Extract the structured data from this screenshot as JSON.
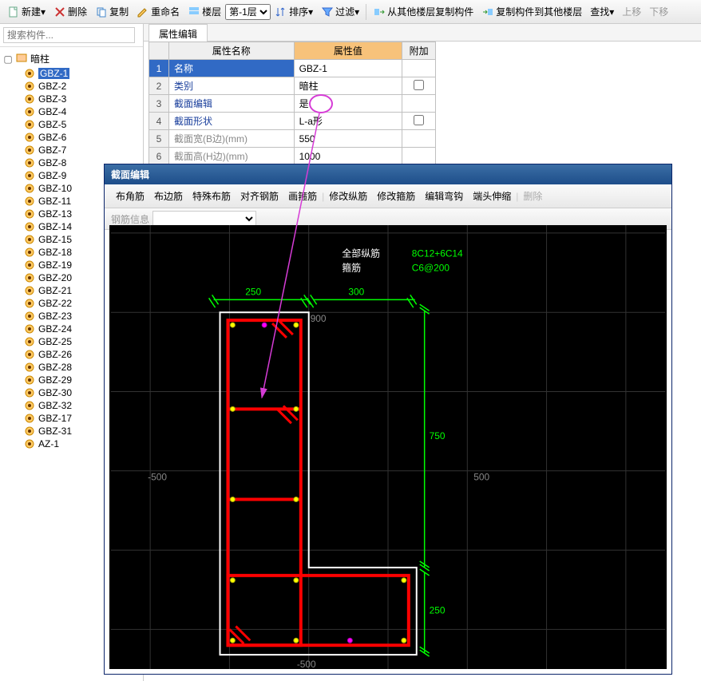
{
  "toolbar": {
    "new": "新建",
    "delete": "删除",
    "copy": "复制",
    "rename": "重命名",
    "floor": "楼层",
    "floor_sel": "第-1层",
    "sort": "排序",
    "filter": "过滤",
    "copy_from": "从其他楼层复制构件",
    "copy_to": "复制构件到其他楼层",
    "find": "查找",
    "up": "上移",
    "down": "下移"
  },
  "search_placeholder": "搜索构件...",
  "tree_root": "暗柱",
  "tree_items": [
    "GBZ-1",
    "GBZ-2",
    "GBZ-3",
    "GBZ-4",
    "GBZ-5",
    "GBZ-6",
    "GBZ-7",
    "GBZ-8",
    "GBZ-9",
    "GBZ-10",
    "GBZ-11",
    "GBZ-13",
    "GBZ-14",
    "GBZ-15",
    "GBZ-18",
    "GBZ-19",
    "GBZ-20",
    "GBZ-21",
    "GBZ-22",
    "GBZ-23",
    "GBZ-24",
    "GBZ-25",
    "GBZ-26",
    "GBZ-28",
    "GBZ-29",
    "GBZ-30",
    "GBZ-32",
    "GBZ-17",
    "GBZ-31",
    "AZ-1"
  ],
  "tab": "属性编辑",
  "headers": {
    "name": "属性名称",
    "value": "属性值",
    "extra": "附加"
  },
  "rows": [
    {
      "n": "1",
      "name": "名称",
      "val": "GBZ-1",
      "chk": null,
      "sel": true
    },
    {
      "n": "2",
      "name": "类别",
      "val": "暗柱",
      "chk": false
    },
    {
      "n": "3",
      "name": "截面编辑",
      "val": "是",
      "chk": null
    },
    {
      "n": "4",
      "name": "截面形状",
      "val": "L-a形",
      "chk": false
    },
    {
      "n": "5",
      "name": "截面宽(B边)(mm)",
      "val": "550",
      "chk": null,
      "gray": true
    },
    {
      "n": "6",
      "name": "截面高(H边)(mm)",
      "val": "1000",
      "chk": null,
      "gray": true
    }
  ],
  "editor": {
    "title": "截面编辑",
    "menu": [
      "布角筋",
      "布边筋",
      "特殊布筋",
      "对齐钢筋",
      "画箍筋",
      "修改纵筋",
      "修改箍筋",
      "编辑弯钩",
      "端头伸缩",
      "删除"
    ],
    "rebar_label": "钢筋信息"
  },
  "drawing": {
    "label_all": "全部纵筋",
    "label_stirrup": "箍筋",
    "val_all": "8C12+6C14",
    "val_stirrup": "C6@200",
    "dim_250": "250",
    "dim_300": "300",
    "dim_750": "750",
    "dim_250b": "250",
    "axis_900": "900",
    "axis_500a": "-500",
    "axis_500b": "500",
    "axis_n500": "-500"
  }
}
